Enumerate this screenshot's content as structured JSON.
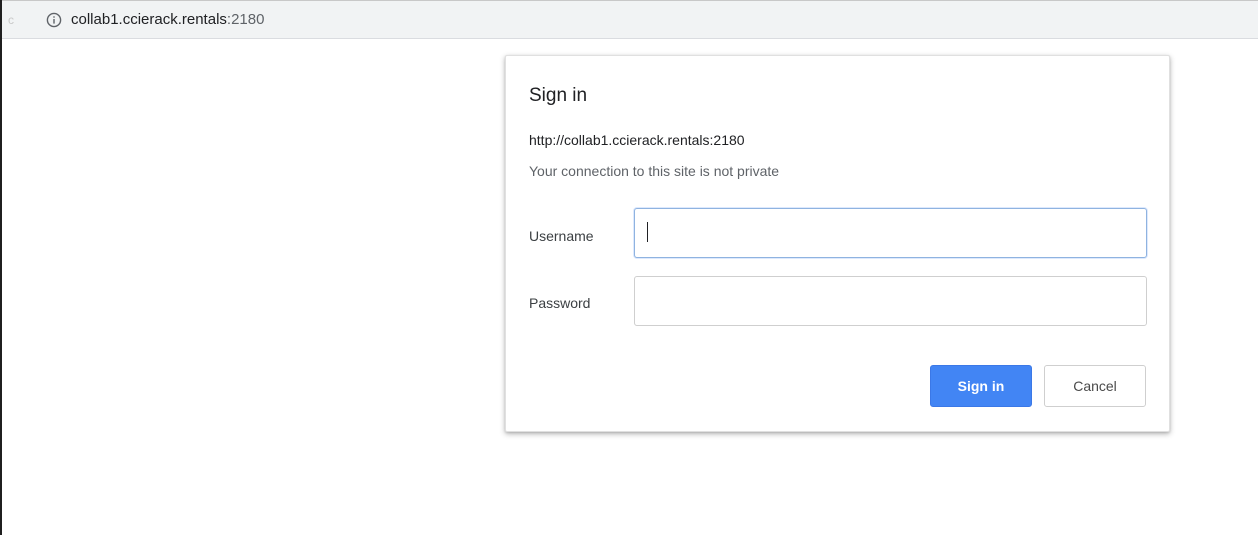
{
  "browser": {
    "url_host": "collab1.ccierack.rentals",
    "url_port": ":2180",
    "info_icon": "info-circle-icon",
    "nav_remnant": "c"
  },
  "dialog": {
    "title": "Sign in",
    "origin": "http://collab1.ccierack.rentals:2180",
    "warning": "Your connection to this site is not private",
    "username_label": "Username",
    "username_value": "",
    "password_label": "Password",
    "password_value": "",
    "submit_label": "Sign in",
    "cancel_label": "Cancel"
  },
  "colors": {
    "accent": "#4285f4",
    "toolbar_bg": "#f1f3f4",
    "focus_border": "#8fb3e0"
  }
}
